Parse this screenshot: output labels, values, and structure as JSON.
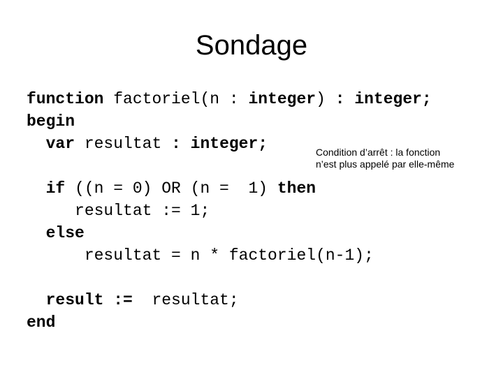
{
  "slide": {
    "title": "Sondage",
    "background_color": "#ffffff",
    "text_color": "#000000"
  },
  "code": {
    "language": "pascal",
    "lines": [
      {
        "id": "line-1",
        "segments": [
          {
            "text": "function ",
            "bold": true
          },
          {
            "text": "factoriel(n : ",
            "bold": false
          },
          {
            "text": "integer",
            "bold": true
          },
          {
            "text": ")",
            "bold": false
          },
          {
            "text": " : integer;",
            "bold": true
          }
        ]
      },
      {
        "id": "line-2",
        "segments": [
          {
            "text": "begin",
            "bold": true
          }
        ]
      },
      {
        "id": "line-3",
        "segments": [
          {
            "text": "  var ",
            "bold": true
          },
          {
            "text": "resultat ",
            "bold": false
          },
          {
            "text": ": integer;",
            "bold": true
          }
        ]
      },
      {
        "id": "line-4",
        "segments": [
          {
            "text": "",
            "bold": false
          }
        ]
      },
      {
        "id": "line-5",
        "segments": [
          {
            "text": "  if ",
            "bold": true
          },
          {
            "text": "((n = 0) OR (n =  1) ",
            "bold": false
          },
          {
            "text": "then",
            "bold": true
          }
        ]
      },
      {
        "id": "line-6",
        "segments": [
          {
            "text": "     resultat := 1;",
            "bold": false
          }
        ]
      },
      {
        "id": "line-7",
        "segments": [
          {
            "text": "  else",
            "bold": true
          }
        ]
      },
      {
        "id": "line-8",
        "segments": [
          {
            "text": "      resultat = n * factoriel(n-1);",
            "bold": false
          }
        ]
      },
      {
        "id": "line-9",
        "segments": [
          {
            "text": "",
            "bold": false
          }
        ]
      },
      {
        "id": "line-10",
        "segments": [
          {
            "text": "  result := ",
            "bold": true
          },
          {
            "text": " resultat;",
            "bold": false
          }
        ]
      },
      {
        "id": "line-11",
        "segments": [
          {
            "text": "end",
            "bold": true
          }
        ]
      }
    ]
  },
  "annotation": {
    "line_1": "Condition d’arrêt : la fonction",
    "line_2": "n’est plus appelé par elle-même"
  }
}
